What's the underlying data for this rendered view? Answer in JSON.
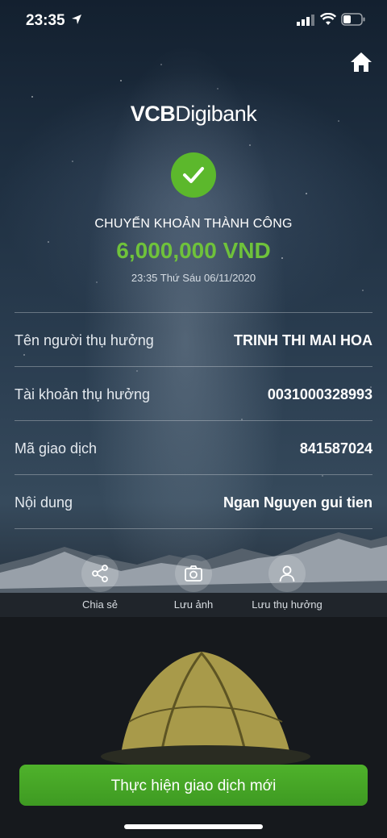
{
  "status_bar": {
    "time": "23:35"
  },
  "logo": {
    "bold": "VCB",
    "light": "Digibank"
  },
  "result": {
    "title": "CHUYỂN KHOẢN THÀNH CÔNG",
    "amount": "6,000,000 VND",
    "datetime": "23:35 Thứ Sáu 06/11/2020"
  },
  "details": [
    {
      "label": "Tên người thụ hưởng",
      "value": "TRINH THI MAI HOA"
    },
    {
      "label": "Tài khoản thụ hưởng",
      "value": "0031000328993"
    },
    {
      "label": "Mã giao dịch",
      "value": "841587024"
    },
    {
      "label": "Nội dung",
      "value": "Ngan Nguyen gui tien"
    }
  ],
  "actions": [
    {
      "label": "Chia sẻ",
      "icon": "share-icon"
    },
    {
      "label": "Lưu ảnh",
      "icon": "camera-icon"
    },
    {
      "label": "Lưu thụ hưởng",
      "icon": "user-icon"
    }
  ],
  "cta": {
    "label": "Thực hiện giao dịch mới"
  },
  "colors": {
    "accent": "#5cb82c",
    "amount": "#6fc23b"
  }
}
